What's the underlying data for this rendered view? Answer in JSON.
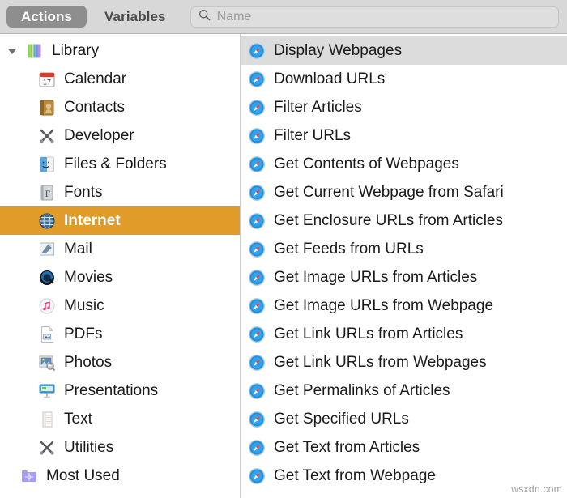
{
  "toolbar": {
    "tabs": [
      {
        "label": "Actions",
        "selected": true
      },
      {
        "label": "Variables",
        "selected": false
      }
    ],
    "search": {
      "icon": "search-icon",
      "placeholder": "Name",
      "value": ""
    }
  },
  "sidebar": {
    "items": [
      {
        "label": "Library",
        "icon": "library-books-icon",
        "level": "group",
        "expanded": true,
        "selected": false
      },
      {
        "label": "Calendar",
        "icon": "calendar-icon",
        "level": "child",
        "selected": false
      },
      {
        "label": "Contacts",
        "icon": "contacts-book-icon",
        "level": "child",
        "selected": false
      },
      {
        "label": "Developer",
        "icon": "developer-tools-icon",
        "level": "child",
        "selected": false
      },
      {
        "label": "Files & Folders",
        "icon": "finder-face-icon",
        "level": "child",
        "selected": false
      },
      {
        "label": "Fonts",
        "icon": "font-book-icon",
        "level": "child",
        "selected": false
      },
      {
        "label": "Internet",
        "icon": "globe-icon",
        "level": "child",
        "selected": true
      },
      {
        "label": "Mail",
        "icon": "mail-stamp-icon",
        "level": "child",
        "selected": false
      },
      {
        "label": "Movies",
        "icon": "quicktime-icon",
        "level": "child",
        "selected": false
      },
      {
        "label": "Music",
        "icon": "music-note-icon",
        "level": "child",
        "selected": false
      },
      {
        "label": "PDFs",
        "icon": "pdf-document-icon",
        "level": "child",
        "selected": false
      },
      {
        "label": "Photos",
        "icon": "photos-icon",
        "level": "child",
        "selected": false
      },
      {
        "label": "Presentations",
        "icon": "presentation-icon",
        "level": "child",
        "selected": false
      },
      {
        "label": "Text",
        "icon": "text-document-icon",
        "level": "child",
        "selected": false
      },
      {
        "label": "Utilities",
        "icon": "developer-tools-icon",
        "level": "child",
        "selected": false
      },
      {
        "label": "Most Used",
        "icon": "smart-folder-icon",
        "level": "group2",
        "selected": false
      }
    ]
  },
  "actions": {
    "items": [
      {
        "label": "Display Webpages",
        "icon": "safari-compass-icon",
        "selected": true
      },
      {
        "label": "Download URLs",
        "icon": "safari-compass-icon",
        "selected": false
      },
      {
        "label": "Filter Articles",
        "icon": "safari-compass-icon",
        "selected": false
      },
      {
        "label": "Filter URLs",
        "icon": "safari-compass-icon",
        "selected": false
      },
      {
        "label": "Get Contents of Webpages",
        "icon": "safari-compass-icon",
        "selected": false
      },
      {
        "label": "Get Current Webpage from Safari",
        "icon": "safari-compass-icon",
        "selected": false
      },
      {
        "label": "Get Enclosure URLs from Articles",
        "icon": "safari-compass-icon",
        "selected": false
      },
      {
        "label": "Get Feeds from URLs",
        "icon": "safari-compass-icon",
        "selected": false
      },
      {
        "label": "Get Image URLs from Articles",
        "icon": "safari-compass-icon",
        "selected": false
      },
      {
        "label": "Get Image URLs from Webpage",
        "icon": "safari-compass-icon",
        "selected": false
      },
      {
        "label": "Get Link URLs from Articles",
        "icon": "safari-compass-icon",
        "selected": false
      },
      {
        "label": "Get Link URLs from Webpages",
        "icon": "safari-compass-icon",
        "selected": false
      },
      {
        "label": "Get Permalinks of Articles",
        "icon": "safari-compass-icon",
        "selected": false
      },
      {
        "label": "Get Specified URLs",
        "icon": "safari-compass-icon",
        "selected": false
      },
      {
        "label": "Get Text from Articles",
        "icon": "safari-compass-icon",
        "selected": false
      },
      {
        "label": "Get Text from Webpage",
        "icon": "safari-compass-icon",
        "selected": false
      }
    ]
  },
  "watermark": {
    "text": "wsxdn.com"
  },
  "colors": {
    "selection_orange": "#e09b28",
    "selection_gray": "#dcdcdc",
    "toolbar_bg": "#d8d8d8",
    "tab_active_bg": "#8e8e8e"
  }
}
